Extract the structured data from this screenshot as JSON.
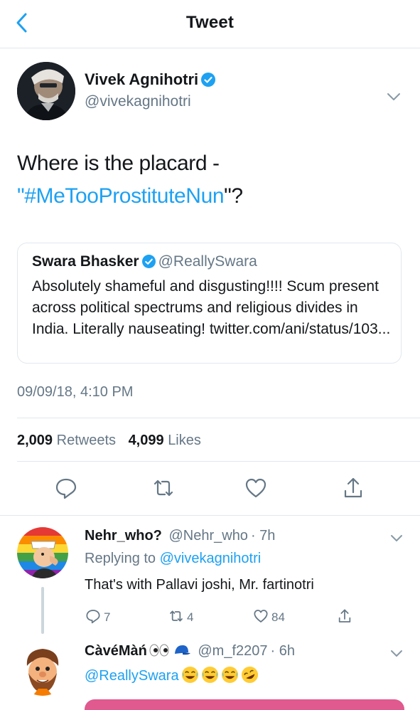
{
  "header": {
    "title": "Tweet"
  },
  "tweet": {
    "author_name": "Vivek Agnihotri",
    "author_handle": "@vivekagnihotri",
    "text_line1": "Where is the placard -",
    "text_open_quote": "\"",
    "hashtag": "#MeTooProstituteNun",
    "text_close": "\"?",
    "timestamp": "09/09/18, 4:10 PM",
    "retweets_count": "2,009",
    "retweets_label": "Retweets",
    "likes_count": "4,099",
    "likes_label": "Likes"
  },
  "quote": {
    "name": "Swara Bhasker",
    "handle": "@ReallySwara",
    "body": "Absolutely shameful and disgusting!!!! Scum present across political spectrums and religious divides in India. Literally nauseating! twitter.com/ani/status/103..."
  },
  "replies": [
    {
      "name": "Nehr_who?",
      "handle": "@Nehr_who",
      "time": "· 7h",
      "replying_prefix": "Replying to",
      "replying_to": "@vivekagnihotri",
      "text": "That's with Pallavi joshi, Mr. fartinotri",
      "reply_count": "7",
      "retweet_count": "4",
      "like_count": "84"
    },
    {
      "name": "CàvéMàń",
      "handle": "@m_f2207",
      "time": "· 6h",
      "mention": "@ReallySwara"
    }
  ],
  "colors": {
    "accent": "#1da1f2",
    "secondary_text": "#657786",
    "divider": "#e1e8ed"
  },
  "icons": {
    "back": "chevron-left-icon",
    "verified": "verified-badge-icon",
    "caret": "chevron-down-icon",
    "reply": "reply-icon",
    "retweet": "retweet-icon",
    "like": "heart-icon",
    "share": "share-icon",
    "emoji": "rolling-laughing-emoji-icon"
  }
}
